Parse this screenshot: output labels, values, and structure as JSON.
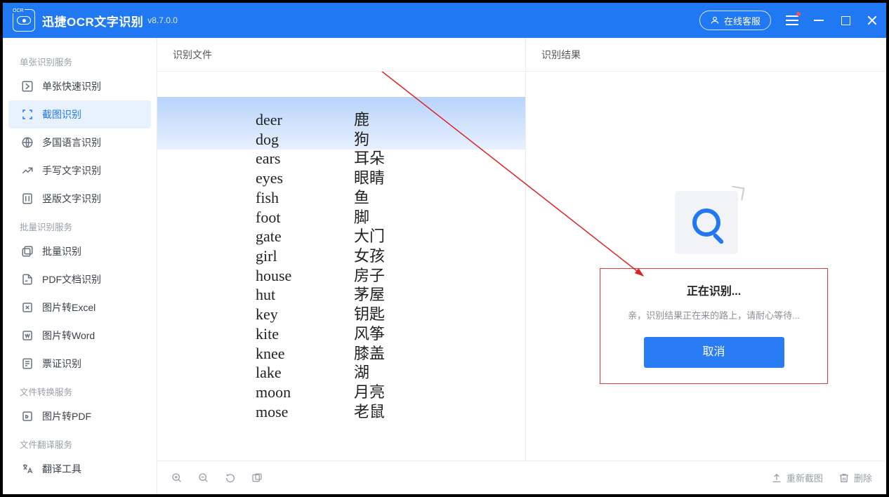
{
  "titlebar": {
    "app_name": "迅捷OCR文字识别",
    "version": "v8.7.0.0",
    "customer_service": "在线客服"
  },
  "sidebar": {
    "groups": [
      {
        "title": "单张识别服务",
        "items": [
          {
            "label": "单张快速识别",
            "icon": "single-fast-icon"
          },
          {
            "label": "截图识别",
            "icon": "screenshot-icon",
            "active": true
          },
          {
            "label": "多国语言识别",
            "icon": "multilang-icon"
          },
          {
            "label": "手写文字识别",
            "icon": "handwriting-icon"
          },
          {
            "label": "竖版文字识别",
            "icon": "vertical-text-icon"
          }
        ]
      },
      {
        "title": "批量识别服务",
        "items": [
          {
            "label": "批量识别",
            "icon": "batch-icon"
          },
          {
            "label": "PDF文档识别",
            "icon": "pdf-doc-icon"
          },
          {
            "label": "图片转Excel",
            "icon": "to-excel-icon"
          },
          {
            "label": "图片转Word",
            "icon": "to-word-icon"
          },
          {
            "label": "票证识别",
            "icon": "receipt-icon"
          }
        ]
      },
      {
        "title": "文件转换服务",
        "items": [
          {
            "label": "图片转PDF",
            "icon": "to-pdf-icon"
          }
        ]
      },
      {
        "title": "文件翻译服务",
        "items": [
          {
            "label": "翻译工具",
            "icon": "translate-icon"
          }
        ]
      }
    ]
  },
  "columns": {
    "left_header": "识别文件",
    "right_header": "识别结果"
  },
  "vocab": [
    {
      "en": "deer",
      "zh": "鹿"
    },
    {
      "en": "dog",
      "zh": "狗"
    },
    {
      "en": "ears",
      "zh": "耳朵"
    },
    {
      "en": "eyes",
      "zh": "眼睛"
    },
    {
      "en": "fish",
      "zh": "鱼"
    },
    {
      "en": "foot",
      "zh": "脚"
    },
    {
      "en": "gate",
      "zh": "大门"
    },
    {
      "en": "girl",
      "zh": "女孩"
    },
    {
      "en": "house",
      "zh": "房子"
    },
    {
      "en": "hut",
      "zh": "茅屋"
    },
    {
      "en": "key",
      "zh": "钥匙"
    },
    {
      "en": "kite",
      "zh": "风筝"
    },
    {
      "en": "knee",
      "zh": "膝盖"
    },
    {
      "en": "lake",
      "zh": "湖"
    },
    {
      "en": "moon",
      "zh": "月亮"
    },
    {
      "en": "mose",
      "zh": "老鼠"
    }
  ],
  "progress": {
    "title": "正在识别...",
    "message": "亲，识别结果正在来的路上，请耐心等待...",
    "cancel": "取消"
  },
  "toolbar": {
    "recapture": "重新截图",
    "delete": "删除"
  }
}
